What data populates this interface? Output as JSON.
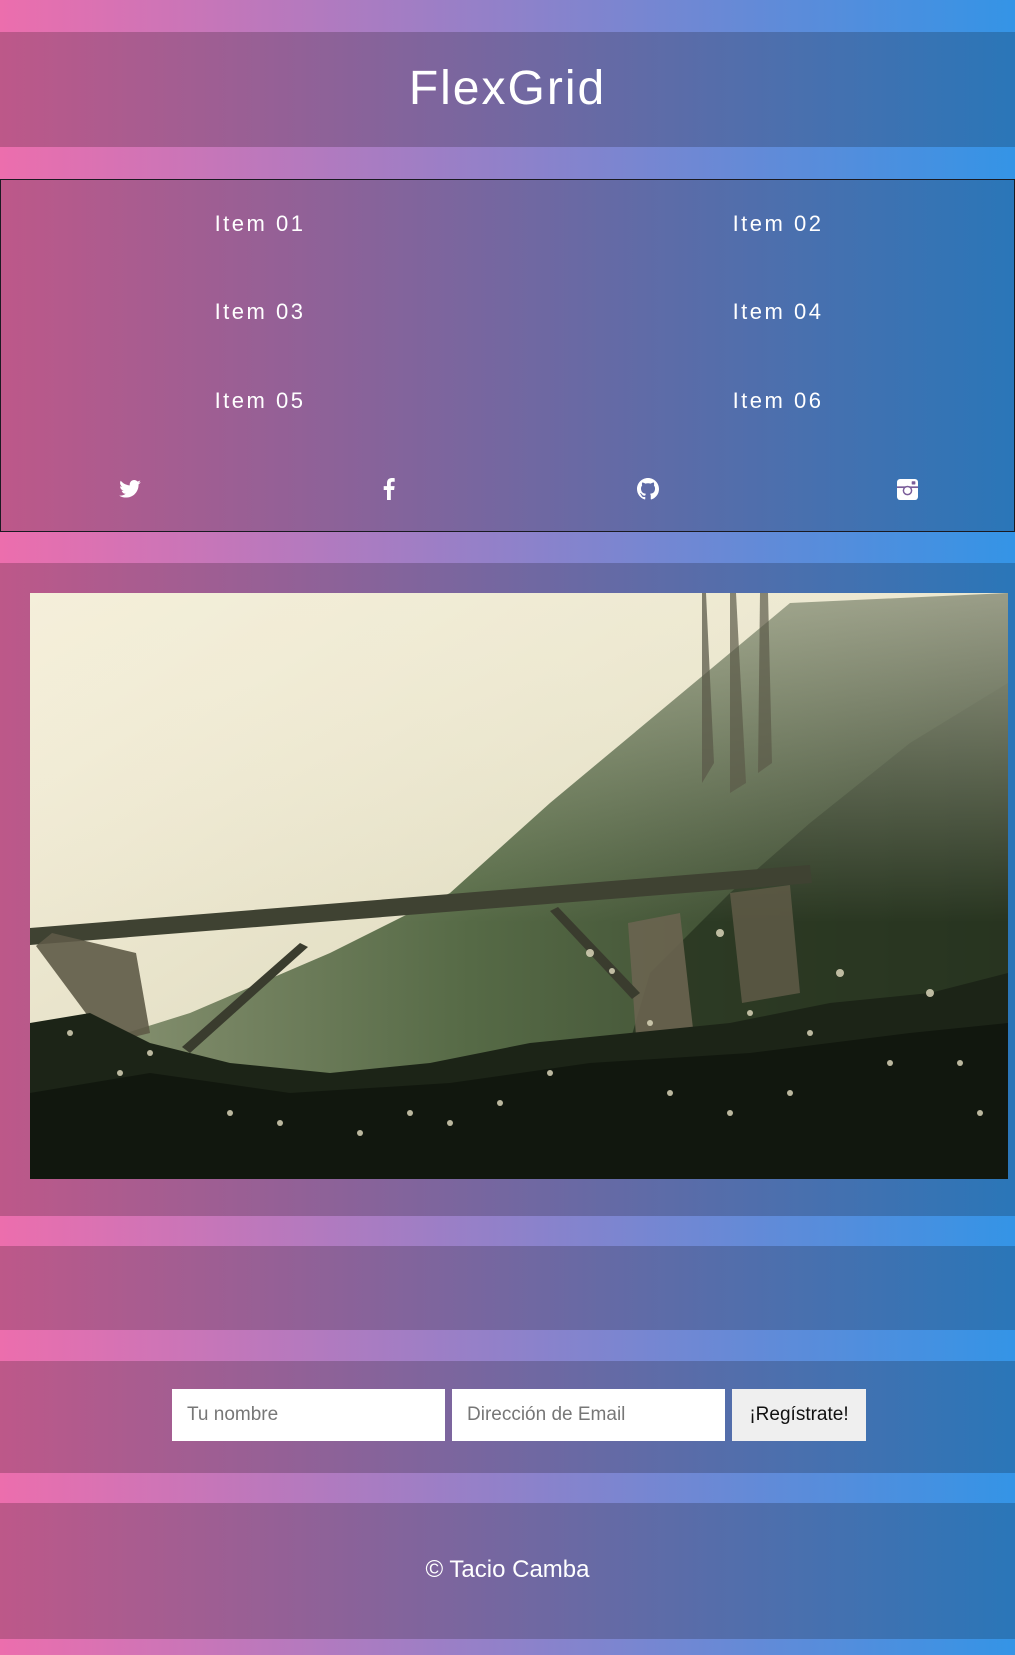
{
  "header": {
    "title": "FlexGrid"
  },
  "nav": {
    "items": [
      {
        "label": "Item 01"
      },
      {
        "label": "Item 02"
      },
      {
        "label": "Item 03"
      },
      {
        "label": "Item 04"
      },
      {
        "label": "Item 05"
      },
      {
        "label": "Item 06"
      }
    ],
    "social": [
      {
        "icon": "twitter-icon"
      },
      {
        "icon": "facebook-icon"
      },
      {
        "icon": "github-icon"
      },
      {
        "icon": "instagram-icon"
      }
    ]
  },
  "hero": {
    "image": "misty-hillside-bridge-photo"
  },
  "signup": {
    "name_placeholder": "Tu nombre",
    "email_placeholder": "Dirección de Email",
    "submit_label": "¡Regístrate!"
  },
  "footer": {
    "copyright": "© Tacio Camba"
  },
  "colors": {
    "gradient_start": "#ec6ead",
    "gradient_end": "#3494e6",
    "panel_start": "#bd5889",
    "panel_end": "#2a76b8",
    "text": "#ffffff",
    "button_bg": "#efefef"
  }
}
